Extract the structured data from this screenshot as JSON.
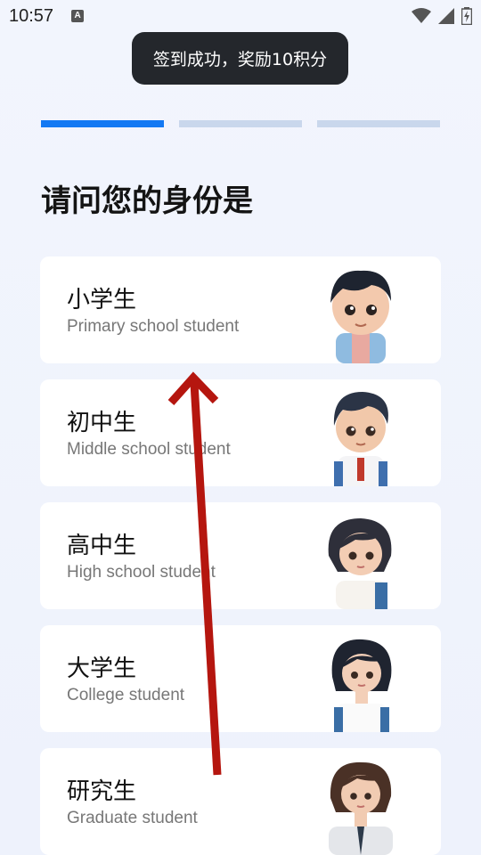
{
  "status_bar": {
    "time": "10:57",
    "notification_icon": "A"
  },
  "toast": {
    "text": "签到成功，奖励10积分"
  },
  "progress": {
    "total_steps": 3,
    "current_step": 1
  },
  "question": {
    "title": "请问您的身份是"
  },
  "options": [
    {
      "zh": "小学生",
      "en": "Primary school student",
      "avatar": "boy-primary-avatar"
    },
    {
      "zh": "初中生",
      "en": "Middle school student",
      "avatar": "boy-middle-avatar"
    },
    {
      "zh": "高中生",
      "en": "High school student",
      "avatar": "girl-high-avatar"
    },
    {
      "zh": "大学生",
      "en": "College student",
      "avatar": "woman-college-avatar"
    },
    {
      "zh": "研究生",
      "en": "Graduate student",
      "avatar": "woman-graduate-avatar"
    }
  ],
  "colors": {
    "accent": "#1479f3",
    "inactive": "#c9d7ec",
    "arrow": "#b5160f"
  }
}
